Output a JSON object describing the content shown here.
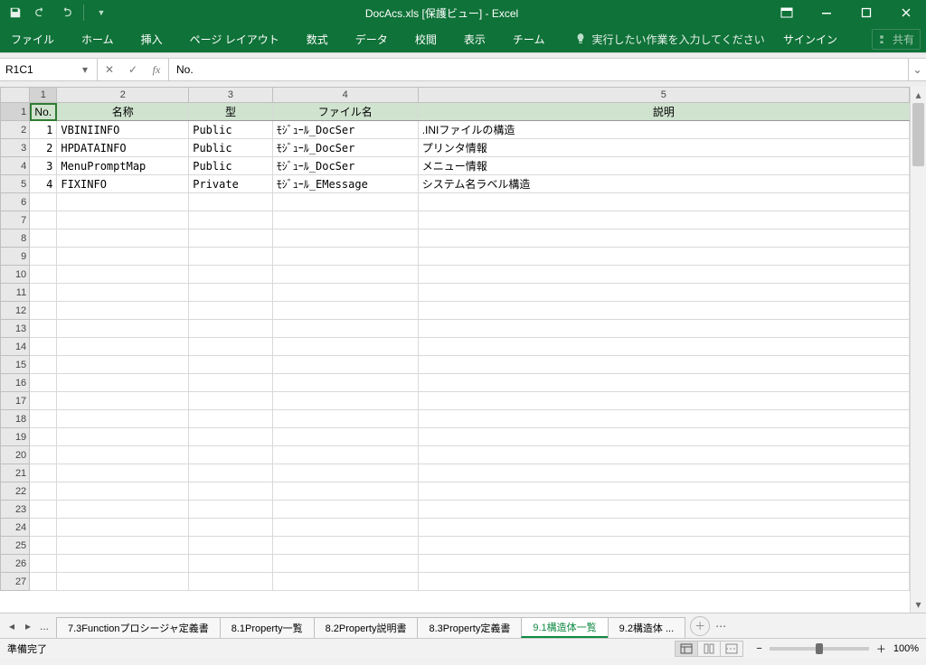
{
  "title": "DocAcs.xls  [保護ビュー] - Excel",
  "qat": {
    "customize_tip": "▼"
  },
  "ribbon": {
    "tabs": [
      "ファイル",
      "ホーム",
      "挿入",
      "ページ レイアウト",
      "数式",
      "データ",
      "校閲",
      "表示",
      "チーム"
    ],
    "tell_me": "実行したい作業を入力してください",
    "signin": "サインイン",
    "share": "共有"
  },
  "namebox": "R1C1",
  "formula": "No.",
  "columns": {
    "headers": [
      "1",
      "2",
      "3",
      "4",
      "5"
    ],
    "widths": [
      32,
      30,
      145,
      92,
      160,
      540
    ]
  },
  "header_row": [
    "No.",
    "名称",
    "型",
    "ファイル名",
    "説明"
  ],
  "rows": [
    {
      "no": "1",
      "name": "VBINIINFO",
      "type": "Public",
      "file": "ﾓｼﾞｭｰﾙ_DocSer",
      "desc": ".INIファイルの構造"
    },
    {
      "no": "2",
      "name": "HPDATAINFO",
      "type": "Public",
      "file": "ﾓｼﾞｭｰﾙ_DocSer",
      "desc": "プリンタ情報"
    },
    {
      "no": "3",
      "name": "MenuPromptMap",
      "type": "Public",
      "file": "ﾓｼﾞｭｰﾙ_DocSer",
      "desc": "メニュー情報"
    },
    {
      "no": "4",
      "name": "FIXINFO",
      "type": "Private",
      "file": "ﾓｼﾞｭｰﾙ_EMessage",
      "desc": "システム名ラベル構造"
    }
  ],
  "empty_rows": 22,
  "row_start": 1,
  "sheet_tabs": {
    "nav_more": "...",
    "tabs": [
      "7.3Functionプロシージャ定義書",
      "8.1Property一覧",
      "8.2Property説明書",
      "8.3Property定義書",
      "9.1構造体一覧",
      "9.2構造体 ..."
    ],
    "active_index": 4
  },
  "status": {
    "ready": "準備完了",
    "zoom": "100%"
  }
}
